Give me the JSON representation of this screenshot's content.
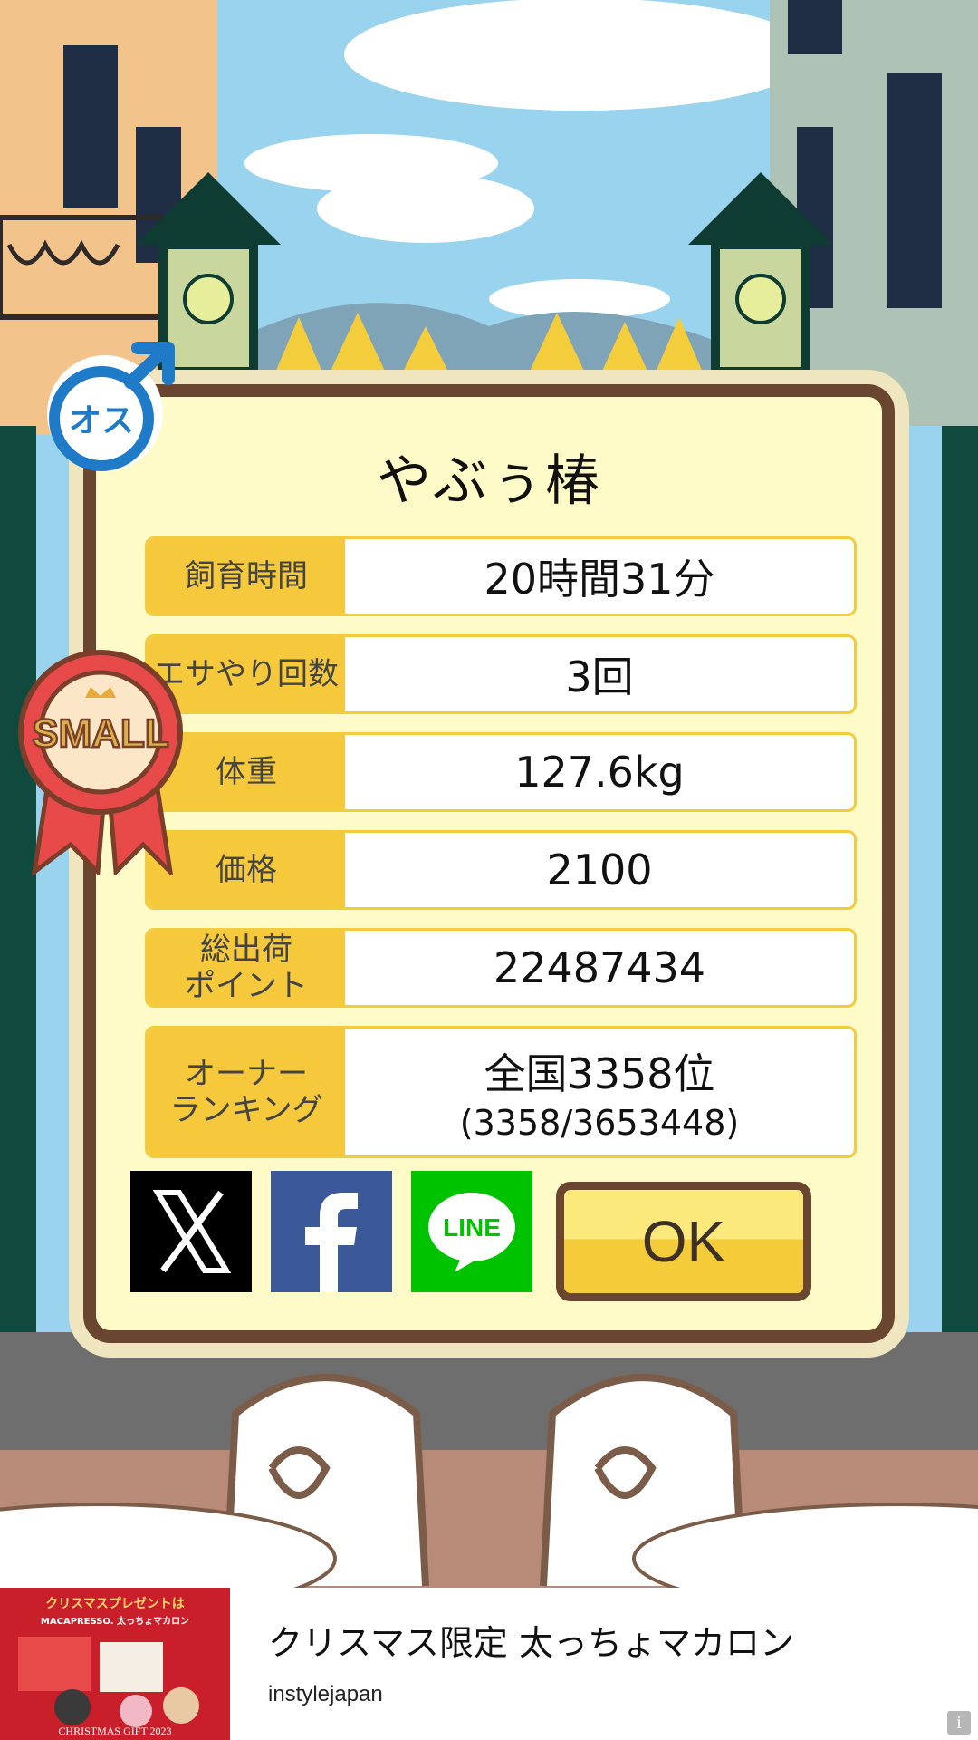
{
  "colors": {
    "sky": "#9ad3ee",
    "card_bg": "#fffbc8",
    "card_border": "#6a4630",
    "label_bg": "#f6c93c",
    "ok_top": "#fbe97c",
    "ok_bottom": "#f4cc3a",
    "x_brand": "#000000",
    "facebook_brand": "#3b5998",
    "line_brand": "#00c300"
  },
  "badges": {
    "gender_text": "オス",
    "gender_icon": "male-symbol-icon",
    "ribbon_text": "SMALL"
  },
  "card": {
    "title": "やぶぅ椿",
    "stats": [
      {
        "label": "飼育時間",
        "value": "20時間31分"
      },
      {
        "label": "エサやり回数",
        "value": "3回"
      },
      {
        "label": "体重",
        "value": "127.6kg"
      },
      {
        "label": "価格",
        "value": "2100"
      },
      {
        "label": "総出荷\nポイント",
        "value": "22487434"
      },
      {
        "label": "オーナー\nランキング",
        "value": "全国3358位",
        "sub": "(3358/3653448)"
      }
    ]
  },
  "share": {
    "x_icon": "x-logo-icon",
    "facebook_icon": "facebook-logo-icon",
    "line_label": "LINE"
  },
  "ok_label": "OK",
  "ad": {
    "banner_heading": "クリスマスプレゼントは\nMACAPRESSO. 太っちょマカロン",
    "banner_footer": "CHRISTMAS GIFT 2023",
    "title": "クリスマス限定 太っちょマカロン",
    "source": "instylejapan",
    "info_label": "i"
  }
}
